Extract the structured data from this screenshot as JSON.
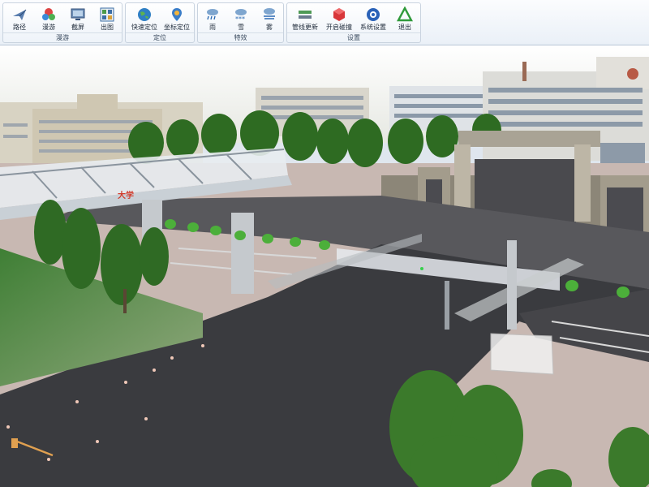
{
  "ribbon": {
    "groups": [
      {
        "label": "漫游",
        "buttons": [
          {
            "label": "路径",
            "icon": "path-plane-icon"
          },
          {
            "label": "漫游",
            "icon": "roam-icon"
          },
          {
            "label": "截屏",
            "icon": "screenshot-icon"
          },
          {
            "label": "出图",
            "icon": "export-map-icon"
          }
        ]
      },
      {
        "label": "定位",
        "buttons": [
          {
            "label": "快速定位",
            "icon": "globe-locate-icon"
          },
          {
            "label": "坐标定位",
            "icon": "coordinate-pin-icon"
          }
        ]
      },
      {
        "label": "特效",
        "buttons": [
          {
            "label": "雨",
            "icon": "rain-icon"
          },
          {
            "label": "雪",
            "icon": "snow-icon"
          },
          {
            "label": "雾",
            "icon": "fog-icon"
          }
        ]
      },
      {
        "label": "设置",
        "buttons": [
          {
            "label": "管线更新",
            "icon": "pipeline-update-icon"
          },
          {
            "label": "开启碰撞",
            "icon": "collision-icon"
          },
          {
            "label": "系统设置",
            "icon": "system-settings-icon"
          },
          {
            "label": "退出",
            "icon": "exit-icon"
          }
        ]
      }
    ]
  },
  "scene": {
    "bridge_sign": "大学",
    "colors": {
      "sky": "#f3f3f0",
      "asphalt": "#3a3b3f",
      "lawn": "#4f8a3f",
      "tree": "#2e6b22",
      "building": "#d9d6cc",
      "gate": "#8c8678",
      "bridge": "#e8ecef"
    }
  }
}
